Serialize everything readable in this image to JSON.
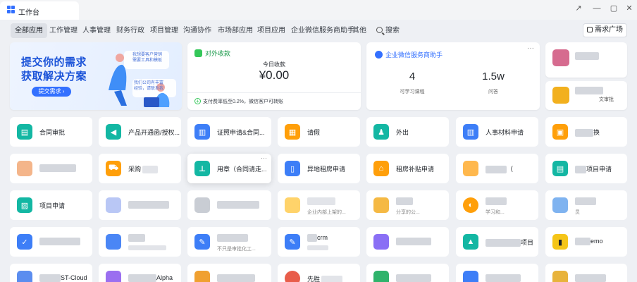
{
  "window": {
    "tab_title": "工作台",
    "buttons": [
      "↗",
      "—",
      "▢",
      "✕"
    ]
  },
  "categories": {
    "items": [
      "全部应用",
      "工作管理",
      "人事管理",
      "财务行政",
      "项目管理",
      "沟通协作",
      "市场部应用",
      "项目应用",
      "企业微信服务商助手",
      "其他"
    ],
    "search": "搜索",
    "demand_button": "需求广场"
  },
  "banner": {
    "line1": "提交你的需求",
    "line2": "获取解决方案",
    "button": "提交需求",
    "bubble1_l1": "我想要客户营销",
    "bubble1_l2": "需要工具和模板",
    "bubble2_l1": "我们公司有丰富",
    "bubble2_l2": "经验，请联系我"
  },
  "income": {
    "title": "对外收款",
    "today_label": "今日收款",
    "amount": "¥0.00",
    "footer": "支付费率低至0.2%，微信客户可转账"
  },
  "wecom": {
    "title": "企业微信服务商助手",
    "more": "···",
    "stat1_value": "4",
    "stat1_label": "可学习课程",
    "stat2_value": "1.5w",
    "stat2_label": "问答"
  },
  "side": {
    "card2_sub": "文审批"
  },
  "apps": {
    "row1": [
      "合同审批",
      "产品开通函/授权...",
      "证照申请&合同...",
      "请假",
      "外出",
      "人事材料申请",
      "换"
    ],
    "row2": [
      "",
      "采购",
      "用章（合同请走...",
      "异地租房申请",
      "租房补贴申请",
      "（",
      "项目申请"
    ],
    "row2_more": "···",
    "row3": [
      "项目申请",
      "",
      "",
      "",
      "",
      "",
      ""
    ],
    "row3_sub": [
      "",
      "",
      "",
      "企业内部上架的...",
      "分享的公...",
      "学习和...",
      "员"
    ],
    "row4": [
      "",
      "",
      "",
      "crm",
      "",
      "",
      "emo"
    ],
    "row4_sub": [
      "",
      "",
      "不只是审批化工...",
      "",
      "",
      "项目",
      ""
    ],
    "row5": [
      "ST-Cloud",
      "Alpha",
      "",
      "先胜",
      "",
      "",
      ""
    ]
  },
  "colors": {
    "accent": "#3370ff",
    "green": "#34c759",
    "teal": "#13b7a3",
    "orange": "#ff9f0a"
  }
}
